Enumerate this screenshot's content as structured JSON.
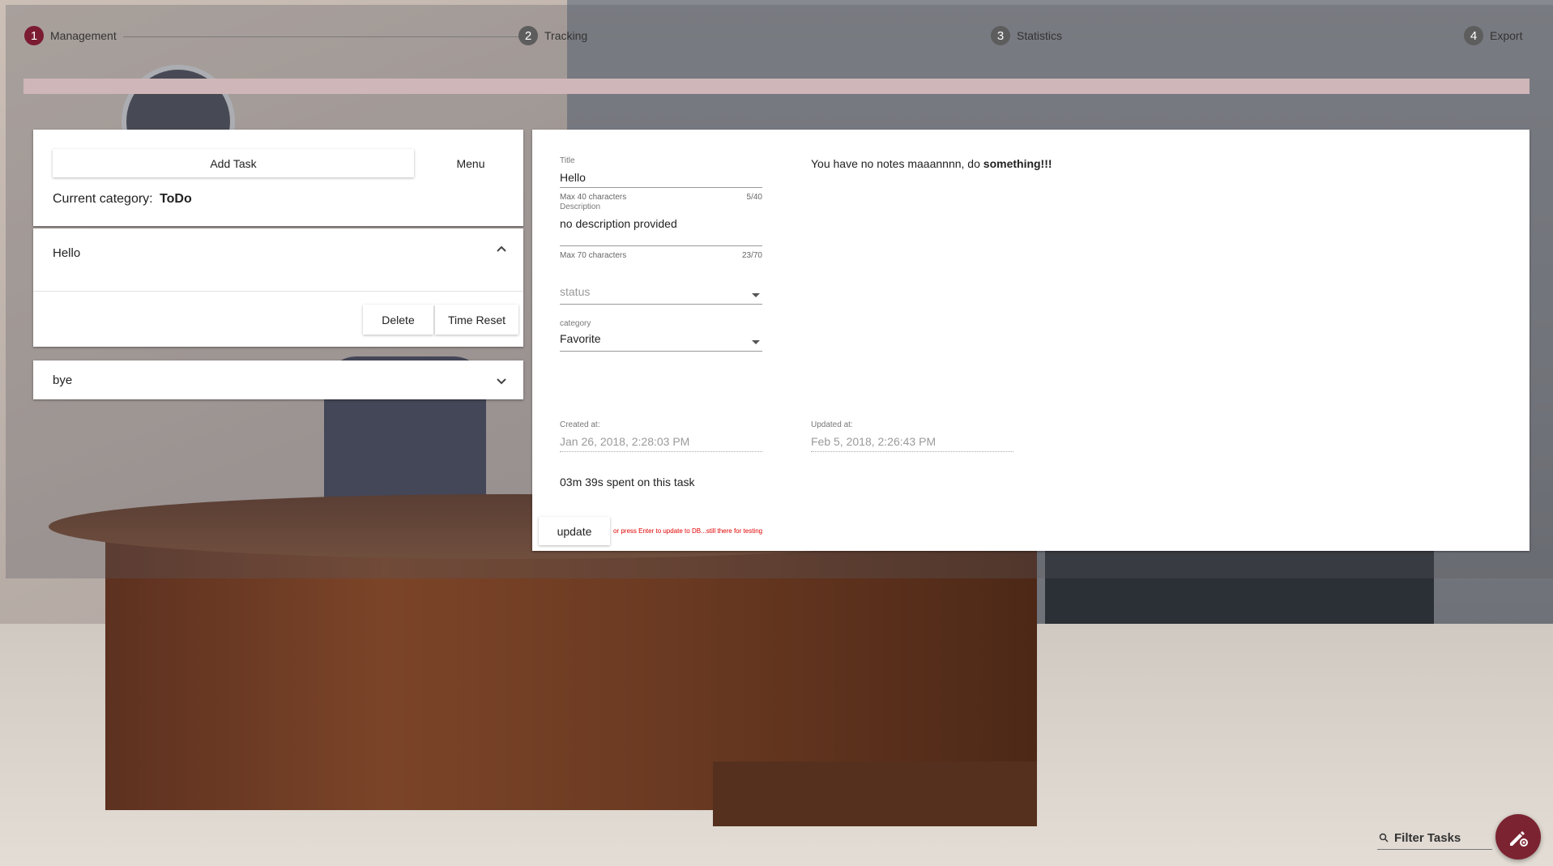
{
  "stepper": {
    "steps": [
      {
        "number": "1",
        "label": "Management"
      },
      {
        "number": "2",
        "label": "Tracking"
      },
      {
        "number": "3",
        "label": "Statistics"
      },
      {
        "number": "4",
        "label": "Export"
      }
    ],
    "active_color": "#7b1c33"
  },
  "progress": {
    "color": "#cfb6b8"
  },
  "left_panel": {
    "add_task_label": "Add Task",
    "menu_label": "Menu",
    "current_category_prefix": "Current category:",
    "current_category": "ToDo",
    "tasks": [
      {
        "title": "Hello",
        "expanded": true,
        "chevron": "chevron-up-icon"
      },
      {
        "title": "bye",
        "expanded": false,
        "chevron": "chevron-down-icon"
      }
    ],
    "delete_label": "Delete",
    "time_reset_label": "Time Reset"
  },
  "detail": {
    "title_label": "Title",
    "title_value": "Hello",
    "title_hint": "Max 40 characters",
    "title_counter": "5/40",
    "description_label": "Description",
    "description_value": "no description provided",
    "description_hint": "Max 70 characters",
    "description_counter": "23/70",
    "status_placeholder": "status",
    "category_label": "category",
    "category_value": "Favorite",
    "created_label": "Created at:",
    "created_value": "Jan 26, 2018, 2:28:03 PM",
    "updated_label": "Updated at:",
    "updated_value": "Feb 5, 2018, 2:26:43 PM",
    "time_spent": "03m 39s spent on this task",
    "update_label": "update",
    "update_hint": "or press Enter to update to DB...still there for testing",
    "notes_prefix": "You have no notes maaannnn, do ",
    "notes_bold": "something!!!"
  },
  "filter": {
    "placeholder": "Filter Tasks",
    "icon": "search-icon"
  },
  "fab": {
    "icon": "edit-settings-icon",
    "color": "#7b2331"
  }
}
